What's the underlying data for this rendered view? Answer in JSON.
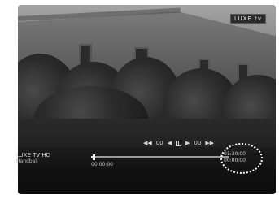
{
  "logo": {
    "text": "LUXE.tv"
  },
  "osd": {
    "transport": {
      "rewind": "◀◀",
      "rewind_label": "00",
      "prev": "◀",
      "next": "▶",
      "forward_label": "00",
      "forward": "▶▶",
      "pause_icon": "pause-icon"
    },
    "channel": {
      "name": "LUXE TV HD",
      "subtitle": "Handball"
    },
    "progress": {
      "fraction": 0.02,
      "time_start": "00:00:00",
      "time_end_line1": "01:30:00",
      "time_end_line2": "00:00:00"
    }
  },
  "annotation": {
    "type": "dotted-circle",
    "color": "#ffffff"
  }
}
